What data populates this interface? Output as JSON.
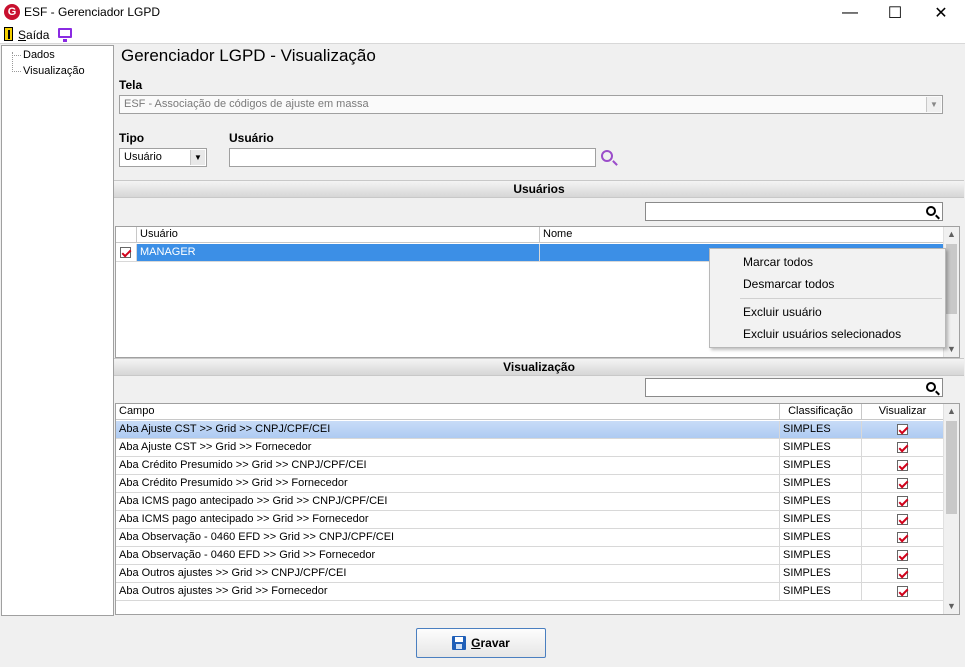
{
  "window": {
    "title": "ESF - Gerenciador LGPD",
    "logo_letter": "G"
  },
  "menu": {
    "saida_accel": "S",
    "saida_rest": "aída"
  },
  "tree": {
    "items": [
      "Dados",
      "Visualização"
    ]
  },
  "page_title": "Gerenciador LGPD - Visualização",
  "form": {
    "tela_label": "Tela",
    "tela_value": "ESF - Associação de códigos de ajuste em massa",
    "tipo_label": "Tipo",
    "tipo_value": "Usuário",
    "usuario_label": "Usuário",
    "usuario_value": ""
  },
  "users_section": {
    "title": "Usuários",
    "filter_value": "",
    "columns": [
      "Usuário",
      "Nome"
    ],
    "rows": [
      {
        "checked": true,
        "usuario": "MANAGER",
        "nome": ""
      }
    ]
  },
  "context_menu": {
    "items": [
      "Marcar todos",
      "Desmarcar todos",
      "Excluir usuário",
      "Excluir usuários selecionados"
    ]
  },
  "vis_section": {
    "title": "Visualização",
    "filter_value": "",
    "columns": [
      "Campo",
      "Classificação",
      "Visualizar"
    ],
    "rows": [
      {
        "campo": "Aba Ajuste CST >> Grid >> CNPJ/CPF/CEI",
        "classificacao": "SIMPLES",
        "visualizar": true
      },
      {
        "campo": "Aba Ajuste CST >> Grid >> Fornecedor",
        "classificacao": "SIMPLES",
        "visualizar": true
      },
      {
        "campo": "Aba Crédito Presumido >> Grid >> CNPJ/CPF/CEI",
        "classificacao": "SIMPLES",
        "visualizar": true
      },
      {
        "campo": "Aba Crédito Presumido >> Grid >> Fornecedor",
        "classificacao": "SIMPLES",
        "visualizar": true
      },
      {
        "campo": "Aba ICMS pago antecipado >> Grid >> CNPJ/CPF/CEI",
        "classificacao": "SIMPLES",
        "visualizar": true
      },
      {
        "campo": "Aba ICMS pago antecipado >> Grid >> Fornecedor",
        "classificacao": "SIMPLES",
        "visualizar": true
      },
      {
        "campo": "Aba Observação - 0460 EFD >> Grid >> CNPJ/CPF/CEI",
        "classificacao": "SIMPLES",
        "visualizar": true
      },
      {
        "campo": "Aba Observação - 0460 EFD >> Grid >> Fornecedor",
        "classificacao": "SIMPLES",
        "visualizar": true
      },
      {
        "campo": "Aba Outros ajustes >> Grid >> CNPJ/CPF/CEI",
        "classificacao": "SIMPLES",
        "visualizar": true
      },
      {
        "campo": "Aba Outros ajustes >> Grid >> Fornecedor",
        "classificacao": "SIMPLES",
        "visualizar": true
      }
    ]
  },
  "gravar_button": {
    "accel": "G",
    "rest": "ravar"
  }
}
